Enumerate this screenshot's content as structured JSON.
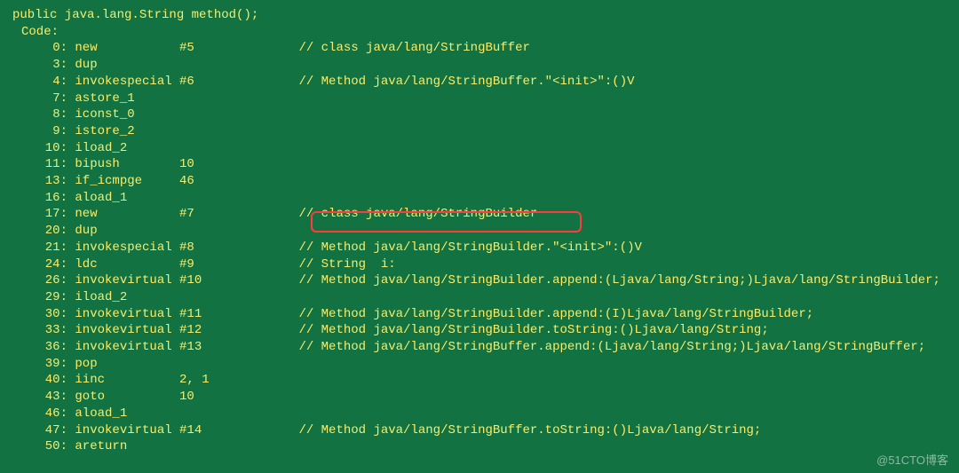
{
  "signature": "public java.lang.String method();",
  "codeLabel": "Code:",
  "lines": [
    {
      "off": "0",
      "mn": "new",
      "arg": "#5",
      "cm": "// class java/lang/StringBuffer"
    },
    {
      "off": "3",
      "mn": "dup",
      "arg": "",
      "cm": ""
    },
    {
      "off": "4",
      "mn": "invokespecial",
      "arg": "#6",
      "cm": "// Method java/lang/StringBuffer.\"<init>\":()V"
    },
    {
      "off": "7",
      "mn": "astore_1",
      "arg": "",
      "cm": ""
    },
    {
      "off": "8",
      "mn": "iconst_0",
      "arg": "",
      "cm": ""
    },
    {
      "off": "9",
      "mn": "istore_2",
      "arg": "",
      "cm": ""
    },
    {
      "off": "10",
      "mn": "iload_2",
      "arg": "",
      "cm": ""
    },
    {
      "off": "11",
      "mn": "bipush",
      "arg": "10",
      "cm": ""
    },
    {
      "off": "13",
      "mn": "if_icmpge",
      "arg": "46",
      "cm": ""
    },
    {
      "off": "16",
      "mn": "aload_1",
      "arg": "",
      "cm": ""
    },
    {
      "off": "17",
      "mn": "new",
      "arg": "#7",
      "cm": "// class java/lang/StringBuilder"
    },
    {
      "off": "20",
      "mn": "dup",
      "arg": "",
      "cm": ""
    },
    {
      "off": "21",
      "mn": "invokespecial",
      "arg": "#8",
      "cm": "// Method java/lang/StringBuilder.\"<init>\":()V"
    },
    {
      "off": "24",
      "mn": "ldc",
      "arg": "#9",
      "cm": "// String  i:"
    },
    {
      "off": "26",
      "mn": "invokevirtual",
      "arg": "#10",
      "cm": "// Method java/lang/StringBuilder.append:(Ljava/lang/String;)Ljava/lang/StringBuilder;"
    },
    {
      "off": "29",
      "mn": "iload_2",
      "arg": "",
      "cm": ""
    },
    {
      "off": "30",
      "mn": "invokevirtual",
      "arg": "#11",
      "cm": "// Method java/lang/StringBuilder.append:(I)Ljava/lang/StringBuilder;"
    },
    {
      "off": "33",
      "mn": "invokevirtual",
      "arg": "#12",
      "cm": "// Method java/lang/StringBuilder.toString:()Ljava/lang/String;"
    },
    {
      "off": "36",
      "mn": "invokevirtual",
      "arg": "#13",
      "cm": "// Method java/lang/StringBuffer.append:(Ljava/lang/String;)Ljava/lang/StringBuffer;"
    },
    {
      "off": "39",
      "mn": "pop",
      "arg": "",
      "cm": ""
    },
    {
      "off": "40",
      "mn": "iinc",
      "arg": "2, 1",
      "cm": ""
    },
    {
      "off": "43",
      "mn": "goto",
      "arg": "10",
      "cm": ""
    },
    {
      "off": "46",
      "mn": "aload_1",
      "arg": "",
      "cm": ""
    },
    {
      "off": "47",
      "mn": "invokevirtual",
      "arg": "#14",
      "cm": "// Method java/lang/StringBuffer.toString:()Ljava/lang/String;"
    },
    {
      "off": "50",
      "mn": "areturn",
      "arg": "",
      "cm": ""
    }
  ],
  "watermark": "@51CTO博客"
}
